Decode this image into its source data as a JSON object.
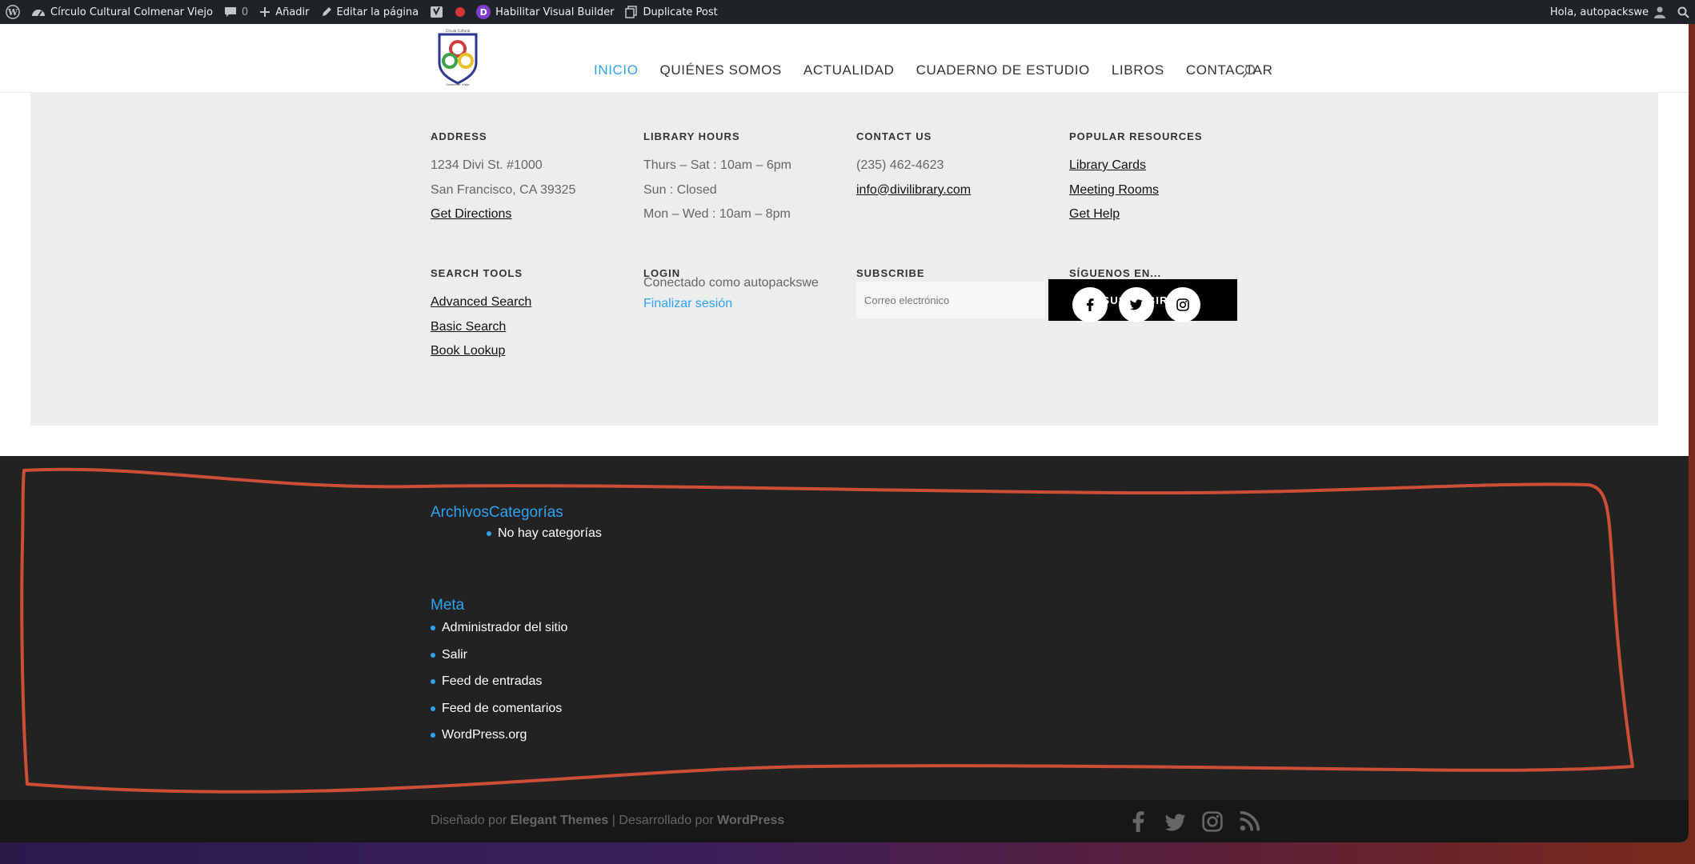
{
  "adminbar": {
    "site_name": "Círculo Cultural Colmenar Viejo",
    "comments_count": "0",
    "add_label": "Añadir",
    "edit_label": "Editar la página",
    "visual_builder_label": "Habilitar Visual Builder",
    "divi_letter": "D",
    "duplicate_label": "Duplicate Post",
    "greeting": "Hola, autopackswe"
  },
  "header": {
    "logo_top_text": "Círculo Cultural",
    "logo_bottom_text": "Colmenar Viejo",
    "nav": [
      "INICIO",
      "QUIÉNES SOMOS",
      "ACTUALIDAD",
      "CUADERNO DE ESTUDIO",
      "LIBROS",
      "CONTACTAR"
    ],
    "active_index": 0
  },
  "widgets": {
    "address": {
      "title": "ADDRESS",
      "line1": "1234 Divi St. #1000",
      "line2": "San Francisco, CA 39325",
      "link": "Get Directions"
    },
    "hours": {
      "title": "LIBRARY HOURS",
      "line1": "Thurs – Sat : 10am – 6pm",
      "line2": "Sun : Closed",
      "line3": "Mon – Wed : 10am – 8pm"
    },
    "contact": {
      "title": "CONTACT US",
      "phone": "(235) 462-4623",
      "email": "info@divilibrary.com"
    },
    "resources": {
      "title": "POPULAR RESOURCES",
      "links": [
        "Library Cards",
        "Meeting Rooms",
        "Get Help"
      ]
    },
    "search_tools": {
      "title": "SEARCH TOOLS",
      "links": [
        "Advanced Search",
        "Basic Search",
        "Book Lookup"
      ]
    },
    "login": {
      "title": "LOGIN",
      "status": "Conectado como autopackswe",
      "logout": "Finalizar sesión"
    },
    "subscribe": {
      "title": "SUBSCRIBE",
      "placeholder": "Correo electrónico",
      "button": "SUSCRIBIRSE"
    },
    "follow": {
      "title": "SÍGUENOS EN...",
      "networks": [
        "facebook-icon",
        "twitter-icon",
        "instagram-icon"
      ]
    }
  },
  "footer": {
    "archives_title": "Archivos",
    "categories_title": "Categorías",
    "categories_empty": "No hay categorías",
    "meta_title": "Meta",
    "meta_links": [
      "Administrador del sitio",
      "Salir",
      "Feed de entradas",
      "Feed de comentarios",
      "WordPress.org"
    ]
  },
  "bottom": {
    "designed_by": "Diseñado por",
    "designer": "Elegant Themes",
    "separator": "|",
    "developed_by": "Desarrollado por",
    "developer": "WordPress",
    "social": [
      "facebook-icon",
      "twitter-icon",
      "instagram-icon",
      "rss-icon"
    ]
  },
  "colors": {
    "accent": "#2ea3f2",
    "annotation": "#e0533a",
    "dark_footer": "#222222",
    "widget_bg": "#ededed"
  }
}
